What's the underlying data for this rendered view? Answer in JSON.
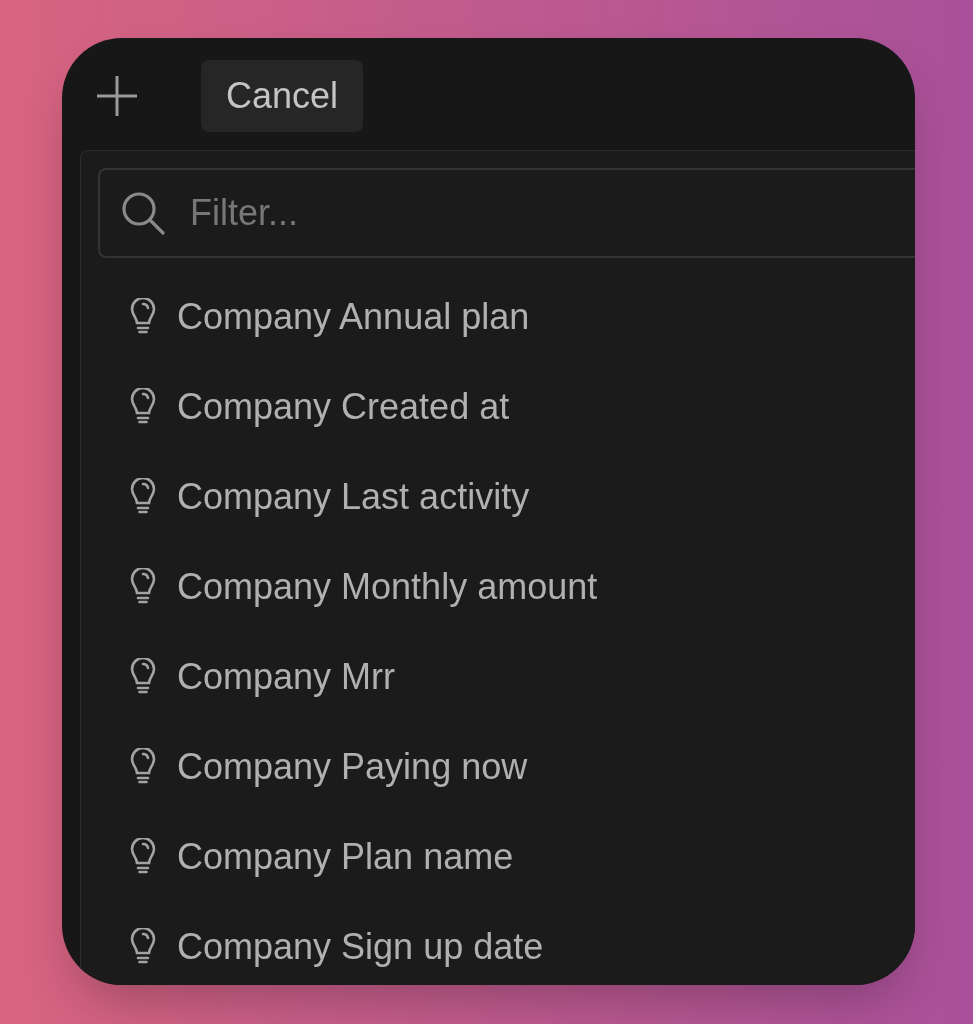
{
  "toolbar": {
    "cancel_label": "Cancel"
  },
  "filter": {
    "placeholder": "Filter..."
  },
  "items": [
    {
      "label": "Company Annual plan"
    },
    {
      "label": "Company Created at"
    },
    {
      "label": "Company Last activity"
    },
    {
      "label": "Company Monthly amount"
    },
    {
      "label": "Company Mrr"
    },
    {
      "label": "Company Paying now"
    },
    {
      "label": "Company Plan name"
    },
    {
      "label": "Company Sign up date"
    }
  ]
}
